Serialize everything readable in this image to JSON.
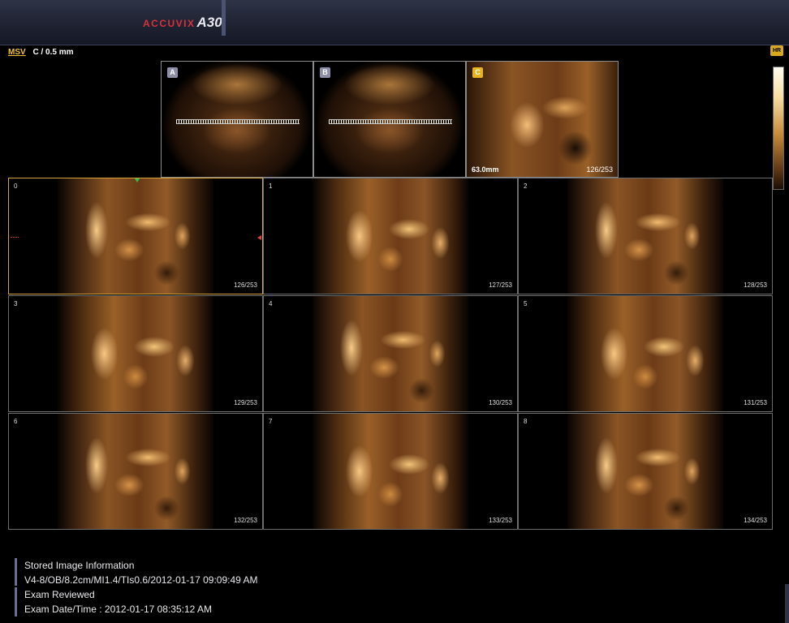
{
  "header": {
    "brand_text": "ACCUVIX",
    "brand_model": "A30",
    "brand_color": "#d8323c"
  },
  "mode": {
    "label": "MSV",
    "slice_thickness": "C / 0.5 mm",
    "hr_icon": "HR"
  },
  "reference_views": [
    {
      "badge": "A",
      "icon": "axial-view"
    },
    {
      "badge": "B",
      "icon": "sagittal-view"
    },
    {
      "badge": "C",
      "distance": "63.0mm",
      "slice": "126/253"
    }
  ],
  "tiles": [
    {
      "index": "0",
      "slice": "126/253",
      "active": true
    },
    {
      "index": "1",
      "slice": "127/253"
    },
    {
      "index": "2",
      "slice": "128/253"
    },
    {
      "index": "3",
      "slice": "129/253"
    },
    {
      "index": "4",
      "slice": "130/253"
    },
    {
      "index": "5",
      "slice": "131/253"
    },
    {
      "index": "6",
      "slice": "132/253"
    },
    {
      "index": "7",
      "slice": "133/253"
    },
    {
      "index": "8",
      "slice": "134/253"
    }
  ],
  "info": {
    "stored_title": "Stored Image Information",
    "stored_detail": "V4-8/OB/8.2cm/MI1.4/TIs0.6/2012-01-17 09:09:49 AM",
    "exam_title": "Exam Reviewed",
    "exam_detail": "Exam Date/Time : 2012-01-17 08:35:12 AM"
  },
  "colors": {
    "accent_gold": "#e7b420",
    "badge_gray": "#8d8fa6",
    "active_border": "#d6a23a"
  }
}
